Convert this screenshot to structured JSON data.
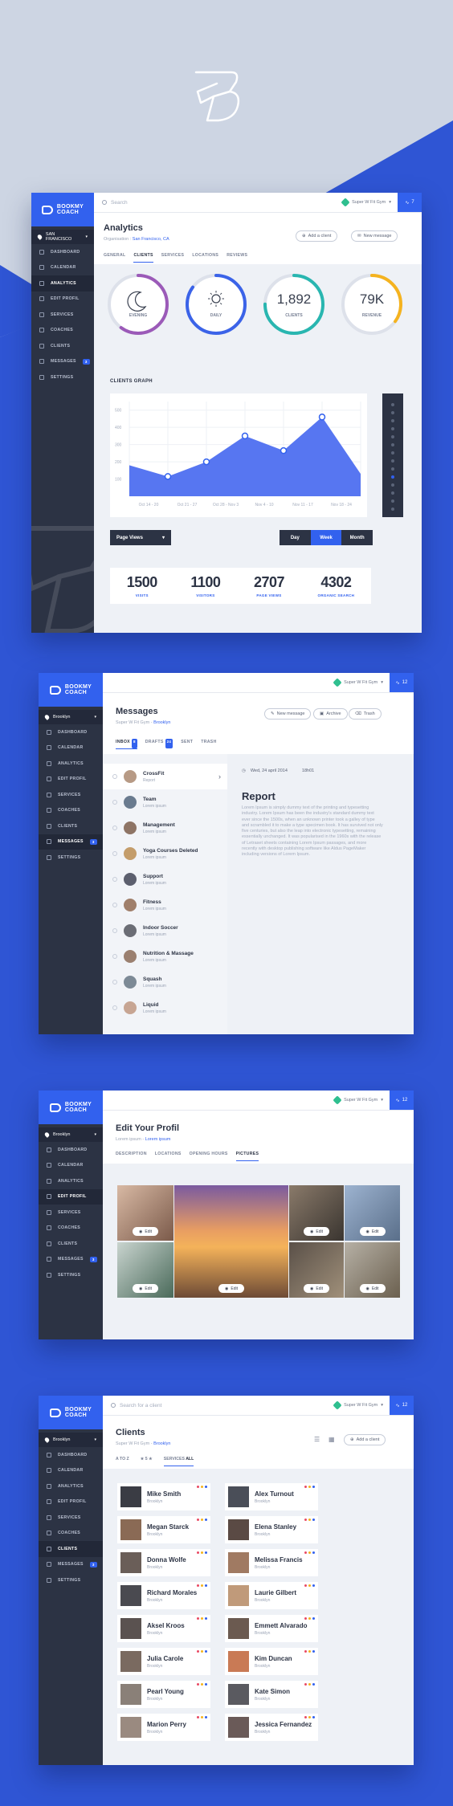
{
  "brand": {
    "line1": "BOOKMY",
    "line2": "COACH"
  },
  "analytics": {
    "location": "SAN FRANCISCO",
    "nav": [
      {
        "label": "DASHBOARD"
      },
      {
        "label": "CALENDAR"
      },
      {
        "label": "ANALYTICS",
        "active": true
      },
      {
        "label": "EDIT PROFIL"
      },
      {
        "label": "SERVICES"
      },
      {
        "label": "COACHES"
      },
      {
        "label": "CLIENTS"
      },
      {
        "label": "MESSAGES",
        "badge": "3"
      },
      {
        "label": "SETTINGS"
      }
    ],
    "search_placeholder": "Search",
    "gym": "Super W Fit Gym",
    "pulse_count": "7",
    "title": "Analytics",
    "org_label": "Organisation : ",
    "org_value": "San Francisco, CA",
    "add_client": "Add a client",
    "new_message": "New message",
    "tabs": [
      "GENERAL",
      "CLIENTS",
      "SERVICES",
      "LOCATIONS",
      "REVIEWS"
    ],
    "active_tab": 1,
    "rings": [
      {
        "label": "EVENING",
        "value": "",
        "icon": "moon-icon",
        "color": "#9b5ab8",
        "fraction": 0.6
      },
      {
        "label": "DAILY",
        "value": "",
        "icon": "sun-icon",
        "color": "#3b63e8",
        "fraction": 0.85
      },
      {
        "label": "CLIENTS",
        "value": "1,892",
        "icon": "",
        "color": "#29b6b0",
        "fraction": 0.75
      },
      {
        "label": "REVENUE",
        "value": "79K",
        "icon": "",
        "color": "#f5b31f",
        "fraction": 0.35
      }
    ],
    "graph_title": "CLIENTS GRAPH",
    "chart_data": {
      "type": "area",
      "title": "CLIENTS GRAPH",
      "categories": [
        "Oct 14 - 20",
        "Oct 21 - 27",
        "Oct 28 - Nov 3",
        "Nov 4 - 10",
        "Nov 11 - 17",
        "Nov 18 - 24"
      ],
      "yticks": [
        100,
        200,
        300,
        400,
        500
      ],
      "ylim": [
        0,
        550
      ],
      "series": [
        {
          "values": [
            180,
            115,
            200,
            350,
            265,
            460,
            130
          ]
        }
      ],
      "grid": true
    },
    "page_views": "Page Views",
    "ranges": [
      "Day",
      "Week",
      "Month"
    ],
    "active_range": 1,
    "stats": [
      {
        "value": "1500",
        "label": "VISITS"
      },
      {
        "value": "1100",
        "label": "VISITORS"
      },
      {
        "value": "2707",
        "label": "PAGE VIEWS"
      },
      {
        "value": "4302",
        "label": "ORGANIC SEARCH"
      }
    ]
  },
  "messages": {
    "location": "Brooklyn",
    "nav_active": "MESSAGES",
    "gym": "Super W Fit Gym",
    "pulse_count": "12",
    "title": "Messages",
    "sub": "Super W Fit Gym - ",
    "sub_link": "Brooklyn",
    "buttons": [
      "New message",
      "Archive",
      "Trash"
    ],
    "tabs": [
      {
        "label": "INBOX",
        "badge": "8"
      },
      {
        "label": "DRAFTS",
        "badge": "24"
      },
      {
        "label": "SENT",
        "badge": ""
      },
      {
        "label": "TRASH",
        "badge": ""
      }
    ],
    "items": [
      {
        "name": "CrossFit",
        "sub": "Report"
      },
      {
        "name": "Team",
        "sub": "Lorem ipsum"
      },
      {
        "name": "Management",
        "sub": "Lorem ipsum"
      },
      {
        "name": "Yoga Courses Deleted",
        "sub": "Lorem ipsum"
      },
      {
        "name": "Support",
        "sub": "Lorem ipsum"
      },
      {
        "name": "Fitness",
        "sub": "Lorem ipsum"
      },
      {
        "name": "Indoor Soccer",
        "sub": "Lorem ipsum"
      },
      {
        "name": "Nutrition & Massage",
        "sub": "Lorem ipsum"
      },
      {
        "name": "Squash",
        "sub": "Lorem ipsum"
      },
      {
        "name": "Liquid",
        "sub": "Lorem ipsum"
      }
    ],
    "date": "Wed, 24 april 2014",
    "time": "18h01",
    "report_title": "Report",
    "report_body": "Lorem Ipsum is simply dummy text of the printing and typesetting industry. Lorem Ipsum has been the industry's standard dummy text ever since the 1500s, when an unknown printer took a galley of type and scrambled it to make a type specimen book. It has survived not only five centuries, but also the leap into electronic typesetting, remaining essentially unchanged. It was popularised in the 1960s with the release of Letraset sheets containing Lorem Ipsum passages, and more recently with desktop publishing software like Aldus PageMaker including versions of Lorem Ipsum."
  },
  "profil": {
    "location": "Brooklyn",
    "gym": "Super W Fit Gym",
    "pulse_count": "12",
    "title": "Edit Your Profil",
    "sub": "Lorem ipsum - ",
    "sub_link": "Lorem ipsum",
    "tabs": [
      "DESCRIPTION",
      "LOCATIONS",
      "OPENING HOURS",
      "PICTURES"
    ],
    "active_tab": 3,
    "edit_label": "Edit"
  },
  "clients": {
    "location": "Brooklyn",
    "gym": "Super W Fit Gym",
    "pulse_count": "12",
    "search_placeholder": "Search for a client",
    "title": "Clients",
    "sub": "Super W Fit Gym - ",
    "sub_link": "Brooklyn",
    "add_client": "Add a client",
    "filter_az": "A TO Z",
    "filter_stars": "★ 5 ★",
    "filter_services": "SERVICES ",
    "filter_all": "ALL",
    "list": [
      {
        "name": "Mike Smith",
        "sub": "Brooklyn"
      },
      {
        "name": "Alex Turnout",
        "sub": "Brooklyn"
      },
      {
        "name": "Megan Starck",
        "sub": "Brooklyn"
      },
      {
        "name": "Elena Stanley",
        "sub": "Brooklyn"
      },
      {
        "name": "Donna Wolfe",
        "sub": "Brooklyn"
      },
      {
        "name": "Melissa Francis",
        "sub": "Brooklyn"
      },
      {
        "name": "Richard Morales",
        "sub": "Brooklyn"
      },
      {
        "name": "Laurie Gilbert",
        "sub": "Brooklyn"
      },
      {
        "name": "Aksel Kroos",
        "sub": "Brooklyn"
      },
      {
        "name": "Emmett Alvarado",
        "sub": "Brooklyn"
      },
      {
        "name": "Julia Carole",
        "sub": "Brooklyn"
      },
      {
        "name": "Kim Duncan",
        "sub": "Brooklyn"
      },
      {
        "name": "Pearl Young",
        "sub": "Brooklyn"
      },
      {
        "name": "Kate Simon",
        "sub": "Brooklyn"
      },
      {
        "name": "Marion Perry",
        "sub": "Brooklyn"
      },
      {
        "name": "Jessica Fernandez",
        "sub": "Brooklyn"
      }
    ]
  },
  "colors": {
    "accent": "#3261ee",
    "sidebar": "#2c3344",
    "background": "#2f55d4"
  }
}
